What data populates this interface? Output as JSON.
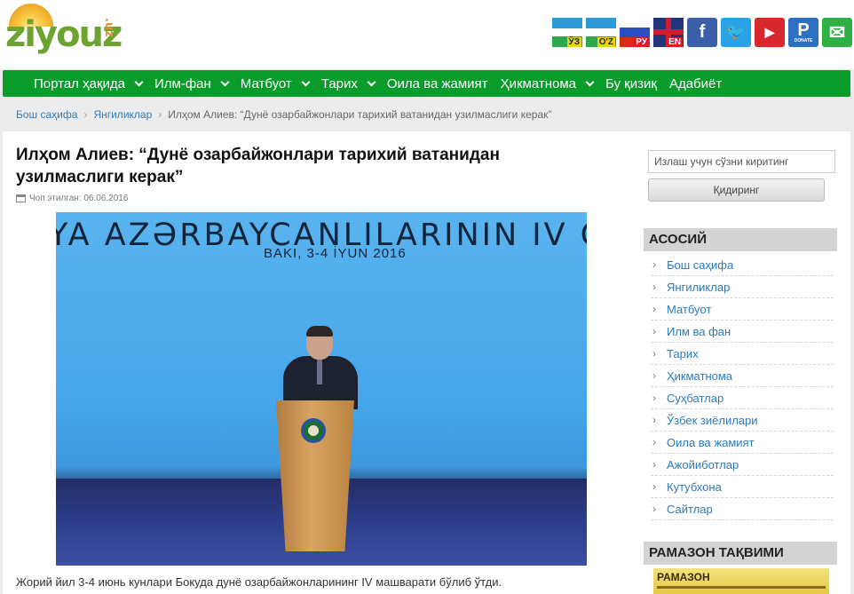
{
  "logo": {
    "text": "ziyouz",
    "tld": ".uz"
  },
  "header_icons": {
    "flags": [
      {
        "name": "uzbek-latin",
        "label": "ЎЗ"
      },
      {
        "name": "uzbek-cyrillic",
        "label": "O'Z"
      },
      {
        "name": "russian",
        "label": "РУ"
      },
      {
        "name": "english",
        "label": "EN"
      }
    ],
    "social": [
      "facebook-icon",
      "twitter-icon",
      "youtube-icon",
      "paypal-donate-icon",
      "mail-icon"
    ],
    "donate_label": "DONATE"
  },
  "nav": [
    {
      "label": "Портал ҳақида",
      "dropdown": true
    },
    {
      "label": "Илм-фан",
      "dropdown": true
    },
    {
      "label": "Матбуот",
      "dropdown": true
    },
    {
      "label": "Тарих",
      "dropdown": true
    },
    {
      "label": "Оила ва жамият",
      "dropdown": false
    },
    {
      "label": "Ҳикматнома",
      "dropdown": true
    },
    {
      "label": "Бу қизиқ",
      "dropdown": false
    },
    {
      "label": "Адабиёт",
      "dropdown": false
    }
  ],
  "breadcrumb": {
    "home": "Бош саҳифа",
    "section": "Янгиликлар",
    "current": "Илҳом Алиев: “Дунё озарбайжонлари тарихий ватанидан узилмаслиги керак”"
  },
  "article": {
    "title": "Илҳом Алиев: “Дунё озарбайжонлари тарихий ватанидан узилмаслиги керак”",
    "published": "Чоп этилган: 06.06.2016",
    "photo_banner": "YA AZƏRBAYCANLILARININ IV QU",
    "photo_sub": "BAKI, 3-4 İYUN 2016",
    "caption": "Жорий йил 3-4 июнь кунлари Бокуда дунё озарбайжонларининг IV машварати бўлиб ўтди."
  },
  "sidebar": {
    "search_placeholder": "Излаш учун сўзни киритинг",
    "search_button": "Қидиринг",
    "main_heading": "АСОСИЙ",
    "items": [
      "Бош саҳифа",
      "Янгиликлар",
      "Матбуот",
      "Илм ва фан",
      "Тарих",
      "Ҳикматнома",
      "Суҳбатлар",
      "Ўзбек зиёлилари",
      "Оила ва жамият",
      "Ажойиботлар",
      "Кутубхона",
      "Сайтлар"
    ],
    "calendar_heading": "РАМАЗОН ТАҚВИМИ",
    "calendar_banner": "РАМАЗОН"
  },
  "colors": {
    "nav_green": "#0a9c2b",
    "link_blue": "#2e7ab9",
    "logo_green": "#6da430"
  }
}
